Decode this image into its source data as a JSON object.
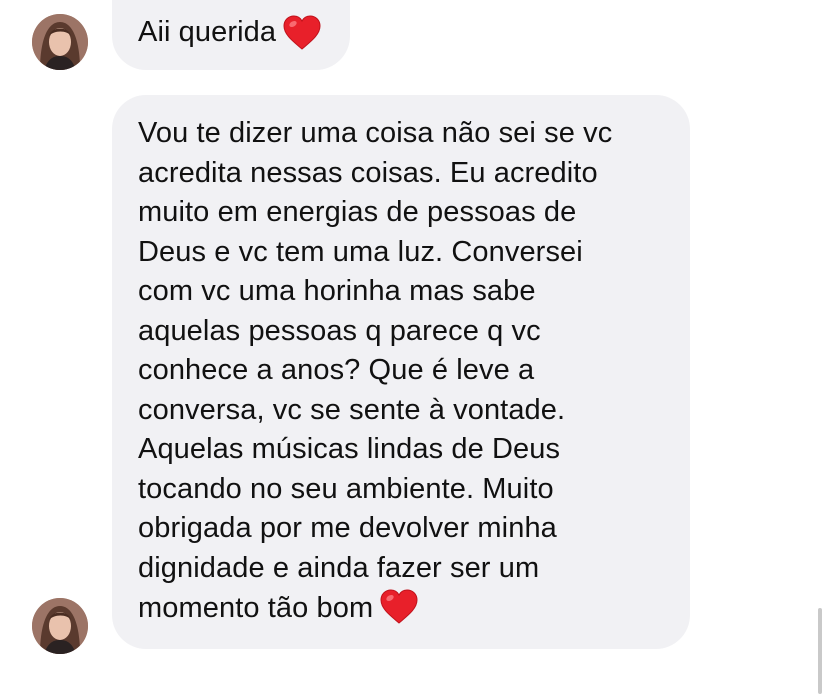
{
  "messages": [
    {
      "text": "Aii querida",
      "emoji": "heart-emoji"
    },
    {
      "lines": [
        "Vou te dizer uma coisa não sei se vc",
        "acredita nessas coisas. Eu acredito",
        "muito em energias de pessoas de",
        "Deus e vc tem uma luz. Conversei",
        "com vc uma horinha mas sabe",
        "aquelas pessoas q parece q vc",
        "conhece a anos? Que é leve a",
        "conversa, vc se sente à vontade.",
        "Aquelas músicas lindas de Deus",
        "tocando no seu ambiente. Muito",
        "obrigada por me devolver minha",
        "dignidade e ainda fazer ser um",
        "momento tão bom"
      ],
      "emoji": "heart-emoji"
    }
  ],
  "colors": {
    "bubble": "#f1f1f4",
    "text": "#111111",
    "heart": "#e8202a"
  }
}
